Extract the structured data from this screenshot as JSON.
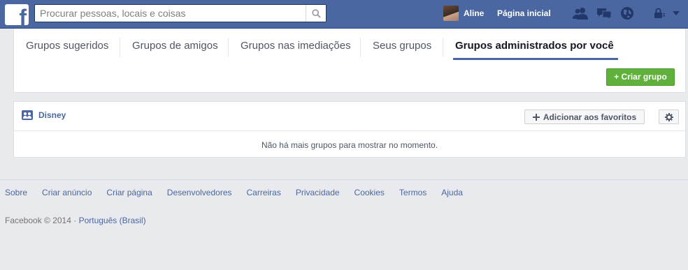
{
  "header": {
    "logo_letter": "f",
    "search": {
      "placeholder": "Procurar pessoas, locais e coisas",
      "value": ""
    },
    "user_name": "Aline",
    "home_label": "Página inicial",
    "icons": [
      "friend-requests-icon",
      "messages-icon",
      "notifications-icon",
      "privacy-shortcuts-icon",
      "account-menu-icon"
    ],
    "colors": {
      "bar": "#4b67a1",
      "accent": "#5fb13c"
    }
  },
  "tabs": [
    {
      "label": "Grupos sugeridos",
      "active": false
    },
    {
      "label": "Grupos de amigos",
      "active": false
    },
    {
      "label": "Grupos nas imediações",
      "active": false
    },
    {
      "label": "Seus grupos",
      "active": false
    },
    {
      "label": "Grupos administrados por você",
      "active": true
    }
  ],
  "create_group_label": "+ Criar grupo",
  "group": {
    "name": "Disney",
    "favorite_label": "Adicionar aos favoritos",
    "empty_message": "Não há mais grupos para mostrar no momento."
  },
  "footer": {
    "links": [
      "Sobre",
      "Criar anúncio",
      "Criar página",
      "Desenvolvedores",
      "Carreiras",
      "Privacidade",
      "Cookies",
      "Termos",
      "Ajuda"
    ],
    "copyright": "Facebook © 2014 · ",
    "language": "Português (Brasil)"
  }
}
